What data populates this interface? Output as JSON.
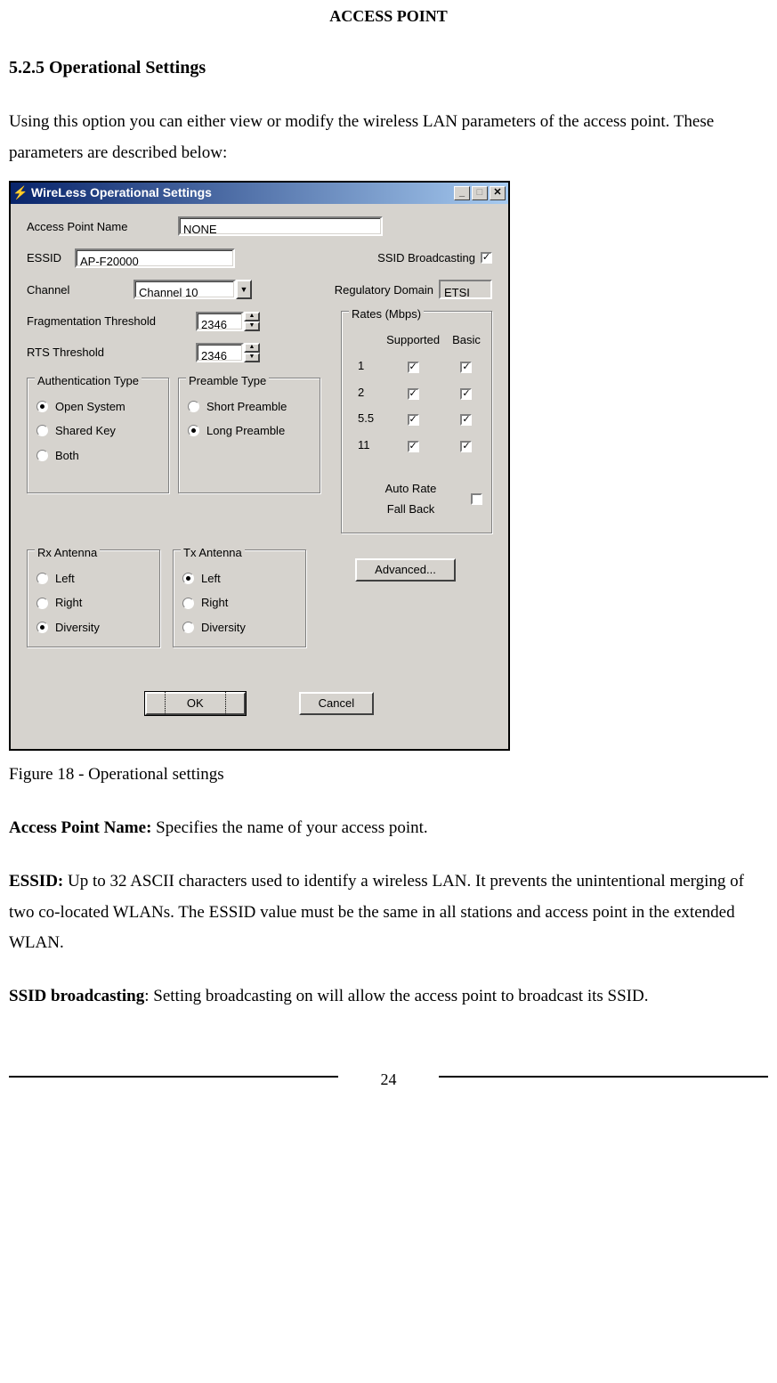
{
  "header": "ACCESS POINT",
  "section_title": "5.2.5 Operational Settings",
  "intro": "Using this option you can either view or modify the wireless LAN parameters of the access point. These parameters are described below:",
  "figure_caption": "Figure 18 - Operational settings",
  "definitions": [
    {
      "term": "Access Point Name: ",
      "text": "Specifies the name of your access point."
    },
    {
      "term": "ESSID: ",
      "text": "Up to 32 ASCII characters used to identify a wireless LAN. It prevents the unintentional merging of two co-located WLANs. The ESSID value must be the same in all stations and access point in the extended WLAN."
    },
    {
      "term": "SSID broadcasting",
      "text": ": Setting broadcasting on will allow the access point to broadcast its SSID."
    }
  ],
  "page_number": "24",
  "dialog": {
    "title": "WireLess Operational Settings",
    "labels": {
      "ap_name": "Access Point Name",
      "essid": "ESSID",
      "ssid_bcast": "SSID Broadcasting",
      "channel": "Channel",
      "reg_domain": "Regulatory Domain",
      "frag": "Fragmentation Threshold",
      "rts": "RTS Threshold",
      "auth_group": "Authentication Type",
      "preamble_group": "Preamble Type",
      "rates_group": "Rates (Mbps)",
      "supported": "Supported",
      "basic": "Basic",
      "auto_rate": "Auto Rate",
      "fall_back": "Fall Back",
      "rx_group": "Rx Antenna",
      "tx_group": "Tx Antenna",
      "advanced": "Advanced...",
      "ok": "OK",
      "cancel": "Cancel"
    },
    "values": {
      "ap_name": "NONE",
      "essid": "AP-F20000",
      "channel": "Channel 10",
      "reg_domain": "ETSI",
      "frag": "2346",
      "rts": "2346",
      "ssid_bcast_checked": true,
      "auto_rate_checked": false
    },
    "auth_options": [
      {
        "label": "Open System",
        "checked": true
      },
      {
        "label": "Shared Key",
        "checked": false
      },
      {
        "label": "Both",
        "checked": false
      }
    ],
    "preamble_options": [
      {
        "label": "Short Preamble",
        "checked": false
      },
      {
        "label": "Long Preamble",
        "checked": true
      }
    ],
    "rates": [
      {
        "rate": "1",
        "supported": true,
        "basic": true
      },
      {
        "rate": "2",
        "supported": true,
        "basic": true
      },
      {
        "rate": "5.5",
        "supported": true,
        "basic": true
      },
      {
        "rate": "11",
        "supported": true,
        "basic": true
      }
    ],
    "rx_options": [
      {
        "label": "Left",
        "checked": false
      },
      {
        "label": "Right",
        "checked": false
      },
      {
        "label": "Diversity",
        "checked": true
      }
    ],
    "tx_options": [
      {
        "label": "Left",
        "checked": true
      },
      {
        "label": "Right",
        "checked": false
      },
      {
        "label": "Diversity",
        "checked": false
      }
    ]
  }
}
